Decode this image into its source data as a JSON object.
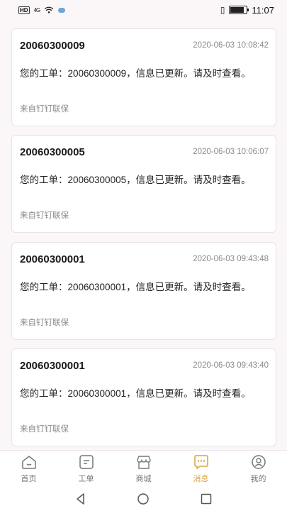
{
  "status_bar": {
    "hd_label": "HD",
    "signal_label": "4G",
    "time": "11:07",
    "battery_level": 0.85
  },
  "messages": [
    {
      "order_no": "20060300009",
      "time": "2020-06-03 10:08:42",
      "body": "您的工单：20060300009，信息已更新。请及时查看。",
      "source": "来自钉钉联保"
    },
    {
      "order_no": "20060300005",
      "time": "2020-06-03 10:06:07",
      "body": "您的工单：20060300005，信息已更新。请及时查看。",
      "source": "来自钉钉联保"
    },
    {
      "order_no": "20060300001",
      "time": "2020-06-03 09:43:48",
      "body": "您的工单：20060300001，信息已更新。请及时查看。",
      "source": "来自钉钉联保"
    },
    {
      "order_no": "20060300001",
      "time": "2020-06-03 09:43:40",
      "body": "您的工单：20060300001，信息已更新。请及时查看。",
      "source": "来自钉钉联保"
    }
  ],
  "tabs": [
    {
      "label": "首页",
      "icon": "home-icon",
      "active": false
    },
    {
      "label": "工单",
      "icon": "work-order-icon",
      "active": false
    },
    {
      "label": "商城",
      "icon": "store-icon",
      "active": false
    },
    {
      "label": "消息",
      "icon": "message-icon",
      "active": true
    },
    {
      "label": "我的",
      "icon": "profile-icon",
      "active": false
    }
  ],
  "colors": {
    "active_tab": "#d9a43a",
    "inactive_tab": "#777777",
    "background": "#fbf6f8"
  }
}
